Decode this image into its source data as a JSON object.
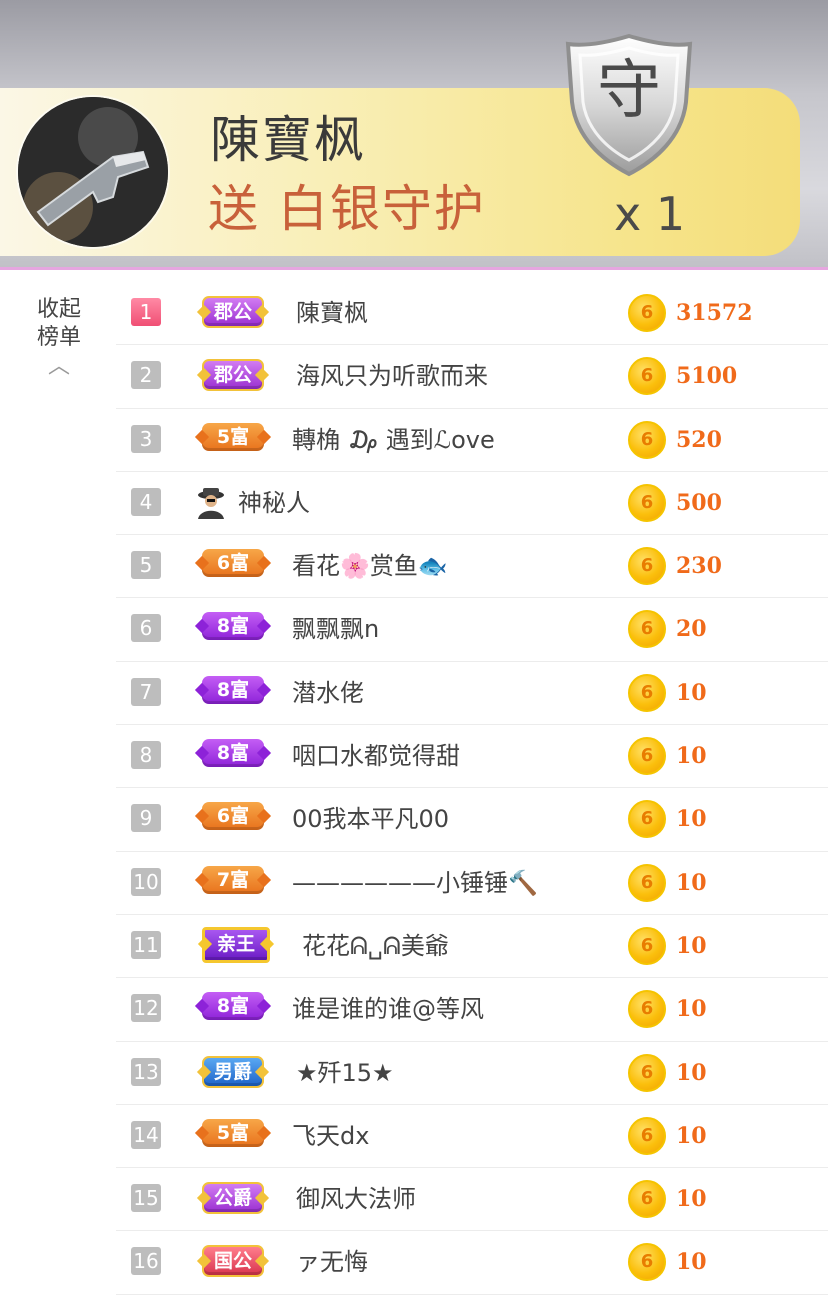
{
  "gift_banner": {
    "sender_name": "陳寶枫",
    "gift_text": "送 白银守护",
    "shield_char": "守",
    "count_text": "x 1"
  },
  "sidebar": {
    "collapse_label": "收起\n榜单",
    "chevron_icon": "chevron-up-icon"
  },
  "colors": {
    "amount": "#f06a1a",
    "coin": "#fbbf0c",
    "rank_first": "#f04f74",
    "rank_default": "#bdbdbd"
  },
  "ranking": [
    {
      "rank": "1",
      "badge": "郡公",
      "badge_style": "gold-purple",
      "name": "陳寶枫",
      "amount": "31572"
    },
    {
      "rank": "2",
      "badge": "郡公",
      "badge_style": "gold-purple",
      "name": "海风只为听歌而来",
      "amount": "5100"
    },
    {
      "rank": "3",
      "badge": "5富",
      "badge_style": "orange",
      "name": "轉桷 ₯ 遇到ℒove",
      "amount": "520"
    },
    {
      "rank": "4",
      "badge": "",
      "badge_style": "mystery",
      "name": "神秘人",
      "amount": "500"
    },
    {
      "rank": "5",
      "badge": "6富",
      "badge_style": "orange",
      "name": "看花🌸赏鱼🐟",
      "amount": "230"
    },
    {
      "rank": "6",
      "badge": "8富",
      "badge_style": "purple",
      "name": "飘飘飘n",
      "amount": "20"
    },
    {
      "rank": "7",
      "badge": "8富",
      "badge_style": "purple",
      "name": "潜水佬",
      "amount": "10"
    },
    {
      "rank": "8",
      "badge": "8富",
      "badge_style": "purple",
      "name": "咽口水都觉得甜",
      "amount": "10"
    },
    {
      "rank": "9",
      "badge": "6富",
      "badge_style": "orange",
      "name": "00我本平凡00",
      "amount": "10"
    },
    {
      "rank": "10",
      "badge": "7富",
      "badge_style": "orange",
      "name": "——————小锤锤🔨",
      "amount": "10"
    },
    {
      "rank": "11",
      "badge": "亲王",
      "badge_style": "prince",
      "name": "花花ᕱ␣ᕱ美爺",
      "amount": "10"
    },
    {
      "rank": "12",
      "badge": "8富",
      "badge_style": "purple",
      "name": "谁是谁的谁@等风",
      "amount": "10"
    },
    {
      "rank": "13",
      "badge": "男爵",
      "badge_style": "blue",
      "name": "★歼15★",
      "amount": "10"
    },
    {
      "rank": "14",
      "badge": "5富",
      "badge_style": "orange",
      "name": "飞天dx",
      "amount": "10"
    },
    {
      "rank": "15",
      "badge": "公爵",
      "badge_style": "gold-purple",
      "name": "御风大法师",
      "amount": "10"
    },
    {
      "rank": "16",
      "badge": "国公",
      "badge_style": "red",
      "name": "ァ无悔",
      "amount": "10"
    }
  ],
  "coin_icon": {
    "name": "gold-coin-icon",
    "glyph": "6"
  }
}
